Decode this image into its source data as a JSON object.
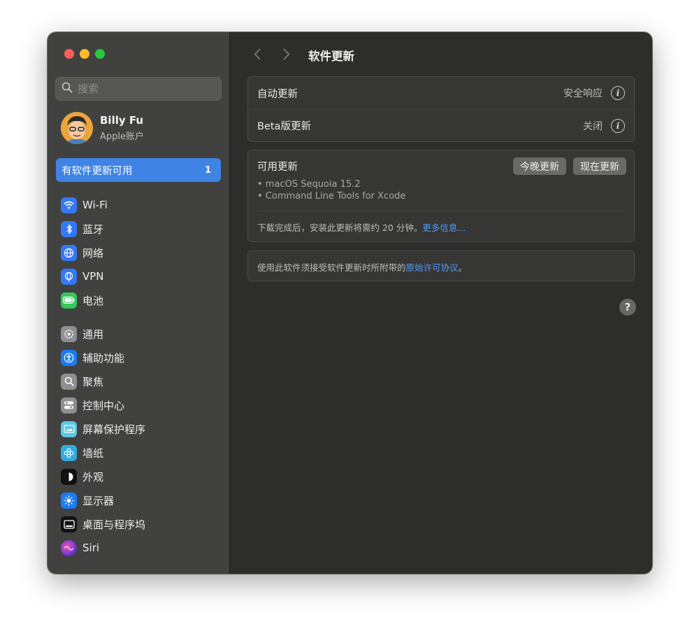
{
  "window": {
    "title": "软件更新"
  },
  "search": {
    "placeholder": "搜索"
  },
  "account": {
    "name": "Billy Fu",
    "subtitle": "Apple账户"
  },
  "sidebar": {
    "update_item": {
      "label": "有软件更新可用",
      "badge": "1"
    },
    "group1": [
      {
        "label": "Wi-Fi",
        "icon": "wifi-icon",
        "color": "#3478f6"
      },
      {
        "label": "蓝牙",
        "icon": "bluetooth-icon",
        "color": "#3478f6"
      },
      {
        "label": "网络",
        "icon": "globe-icon",
        "color": "#3478f6"
      },
      {
        "label": "VPN",
        "icon": "vpn-icon",
        "color": "#3478f6"
      },
      {
        "label": "电池",
        "icon": "battery-icon",
        "color": "#34c759"
      }
    ],
    "group2": [
      {
        "label": "通用",
        "icon": "gear-icon",
        "color": "#8e8e93"
      },
      {
        "label": "辅助功能",
        "icon": "accessibility-icon",
        "color": "#1a7cf5"
      },
      {
        "label": "聚焦",
        "icon": "spotlight-icon",
        "color": "#8e8e93"
      },
      {
        "label": "控制中心",
        "icon": "control-center-icon",
        "color": "#8e8e93"
      },
      {
        "label": "屏幕保护程序",
        "icon": "screensaver-icon",
        "color": "#5ac8e6"
      },
      {
        "label": "墙纸",
        "icon": "wallpaper-icon",
        "color": "#36aadc"
      },
      {
        "label": "外观",
        "icon": "appearance-icon",
        "color": "#111111"
      },
      {
        "label": "显示器",
        "icon": "display-icon",
        "color": "#1a7cf5"
      },
      {
        "label": "桌面与程序坞",
        "icon": "dock-icon",
        "color": "#111111"
      },
      {
        "label": "Siri",
        "icon": "siri-icon",
        "color": "#7a3ce0"
      }
    ]
  },
  "settings": {
    "auto_update": {
      "label": "自动更新",
      "value": "安全响应"
    },
    "beta_update": {
      "label": "Beta版更新",
      "value": "关闭"
    }
  },
  "available": {
    "title": "可用更新",
    "tonight_button": "今晚更新",
    "now_button": "现在更新",
    "items": [
      "• macOS Sequoia 15.2",
      "• Command Line Tools for Xcode"
    ],
    "note": "下载完成后，安装此更新将需约 20 分钟。",
    "more_info": "更多信息..."
  },
  "license": {
    "text": "使用此软件须接受软件更新时所附带的",
    "link": "原始许可协议",
    "suffix": "。"
  },
  "help": {
    "label": "?"
  },
  "colors": {
    "accent": "#3f84e5",
    "link": "#4d9bff",
    "sidebar_bg": "#414140",
    "main_bg": "#2d2d2b"
  }
}
